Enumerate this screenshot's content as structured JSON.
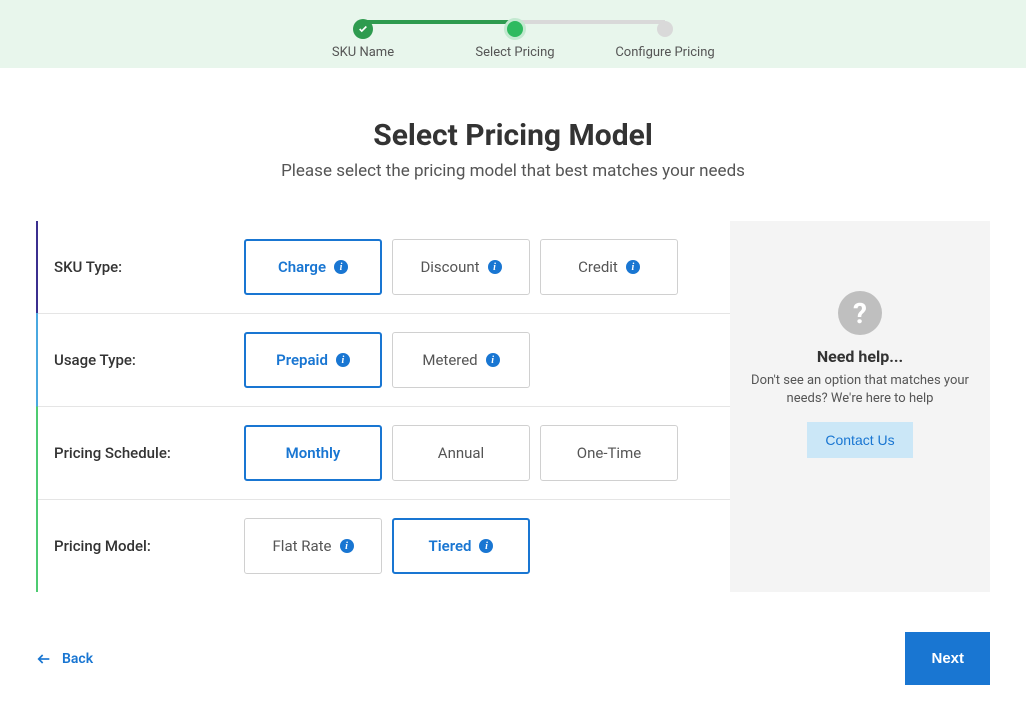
{
  "progress": {
    "steps": [
      {
        "label": "SKU Name",
        "state": "completed"
      },
      {
        "label": "Select Pricing",
        "state": "active"
      },
      {
        "label": "Configure Pricing",
        "state": "pending"
      }
    ]
  },
  "header": {
    "title": "Select Pricing Model",
    "subtitle": "Please select the pricing model that best matches your needs"
  },
  "form": {
    "rows": [
      {
        "label": "SKU Type:",
        "options": [
          {
            "text": "Charge",
            "selected": true,
            "info": true
          },
          {
            "text": "Discount",
            "selected": false,
            "info": true
          },
          {
            "text": "Credit",
            "selected": false,
            "info": true
          }
        ]
      },
      {
        "label": "Usage Type:",
        "options": [
          {
            "text": "Prepaid",
            "selected": true,
            "info": true
          },
          {
            "text": "Metered",
            "selected": false,
            "info": true
          }
        ]
      },
      {
        "label": "Pricing Schedule:",
        "options": [
          {
            "text": "Monthly",
            "selected": true,
            "info": false
          },
          {
            "text": "Annual",
            "selected": false,
            "info": false
          },
          {
            "text": "One-Time",
            "selected": false,
            "info": false
          }
        ]
      },
      {
        "label": "Pricing Model:",
        "options": [
          {
            "text": "Flat Rate",
            "selected": false,
            "info": true
          },
          {
            "text": "Tiered",
            "selected": true,
            "info": true
          }
        ]
      }
    ]
  },
  "help": {
    "title": "Need help...",
    "text": "Don't see an option that matches your needs? We're here to help",
    "button": "Contact Us"
  },
  "nav": {
    "back": "Back",
    "next": "Next"
  }
}
